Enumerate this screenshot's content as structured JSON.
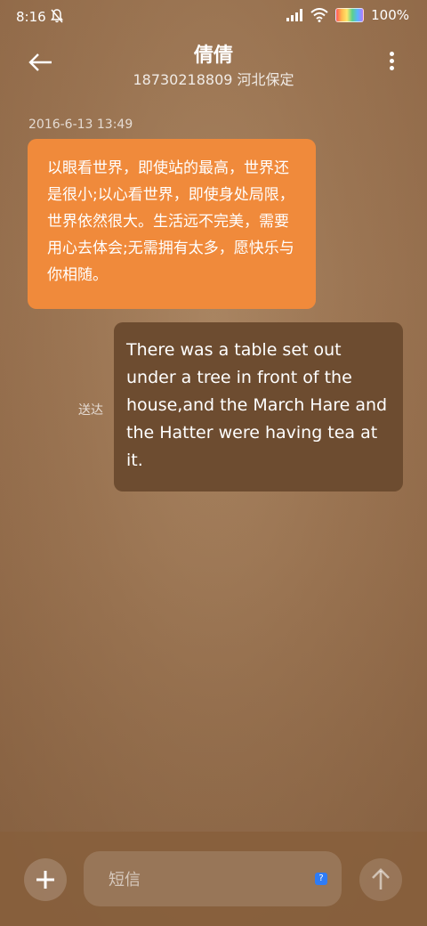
{
  "status_bar": {
    "time": "8:16",
    "battery": "100%"
  },
  "header": {
    "contact_name": "倩倩",
    "contact_detail": "18730218809 河北保定"
  },
  "conversation": {
    "timestamp": "2016-6-13 13:49",
    "outgoing_message": "以眼看世界，即使站的最高，世界还是很小;以心看世界，即使身处局限，世界依然很大。生活远不完美，需要用心去体会;无需拥有太多，愿快乐与你相随。",
    "incoming_message": "There was a table set out under a tree in front of the house,and the March Hare and the Hatter were having tea at it.",
    "delivered_label": "送达"
  },
  "composer": {
    "placeholder": "短信",
    "sim_badge": "?"
  },
  "colors": {
    "outgoing_bubble": "#f08a3b",
    "incoming_bubble": "#6d4c30",
    "sim_badge": "#2e7cf6"
  }
}
